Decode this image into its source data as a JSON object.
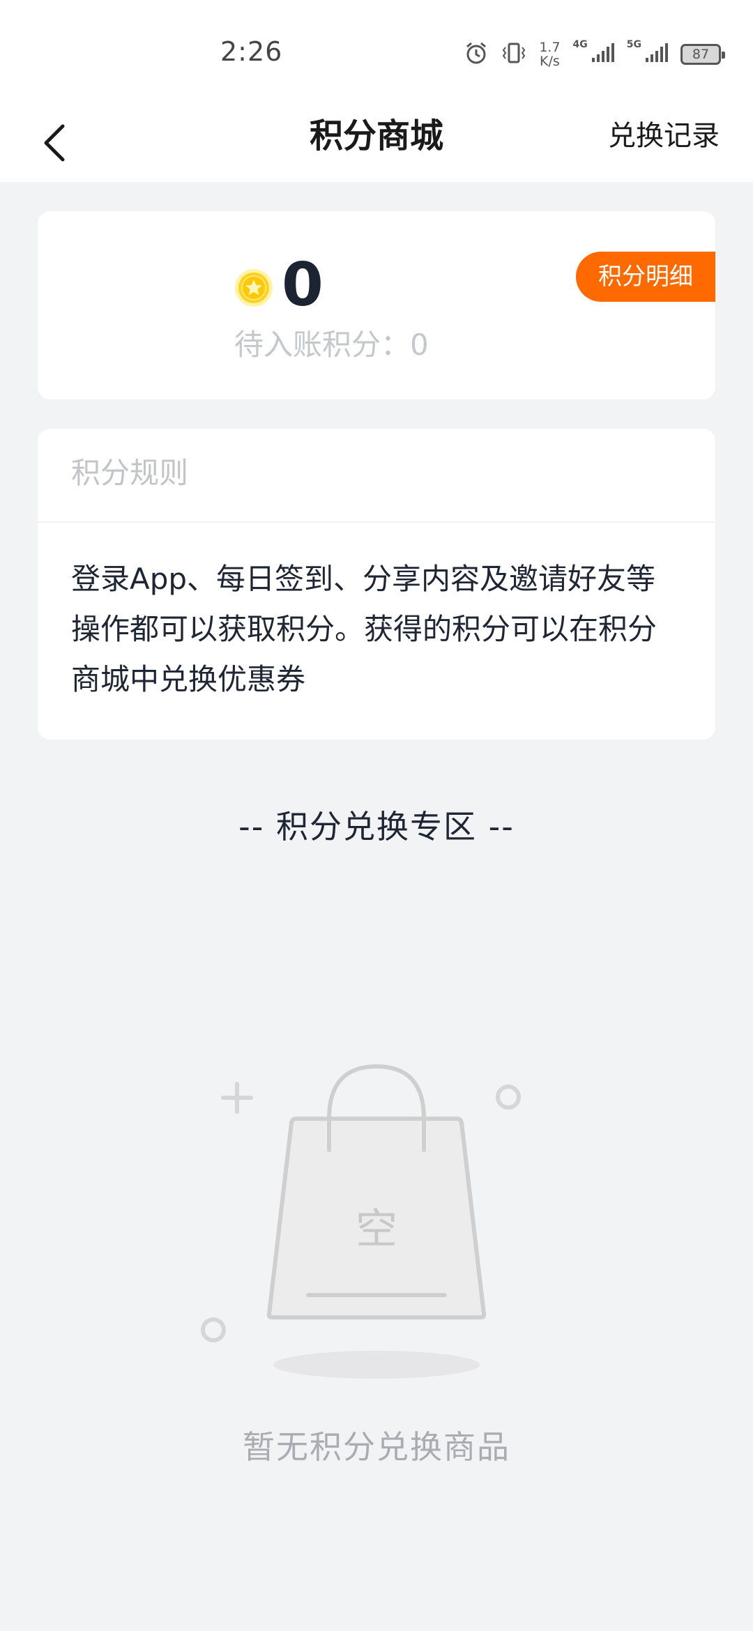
{
  "status_bar": {
    "time": "2:26",
    "net_speed_value": "1.7",
    "net_speed_unit": "K/s",
    "sim1_label": "4G",
    "sim2_label": "5G",
    "battery": "87"
  },
  "nav": {
    "title": "积分商城",
    "right_action": "兑换记录"
  },
  "points": {
    "value": "0",
    "pending_label": "待入账积分：0",
    "detail_button": "积分明细"
  },
  "rules": {
    "title": "积分规则",
    "text": "登录App、每日签到、分享内容及邀请好友等操作都可以获取积分。获得的积分可以在积分商城中兑换优惠券"
  },
  "exchange_zone": {
    "title": "-- 积分兑换专区 --",
    "empty_bag_label": "空",
    "empty_text": "暂无积分兑换商品"
  },
  "colors": {
    "accent": "#ff6a00",
    "background": "#f2f3f5",
    "coin": "#ffd21f"
  }
}
